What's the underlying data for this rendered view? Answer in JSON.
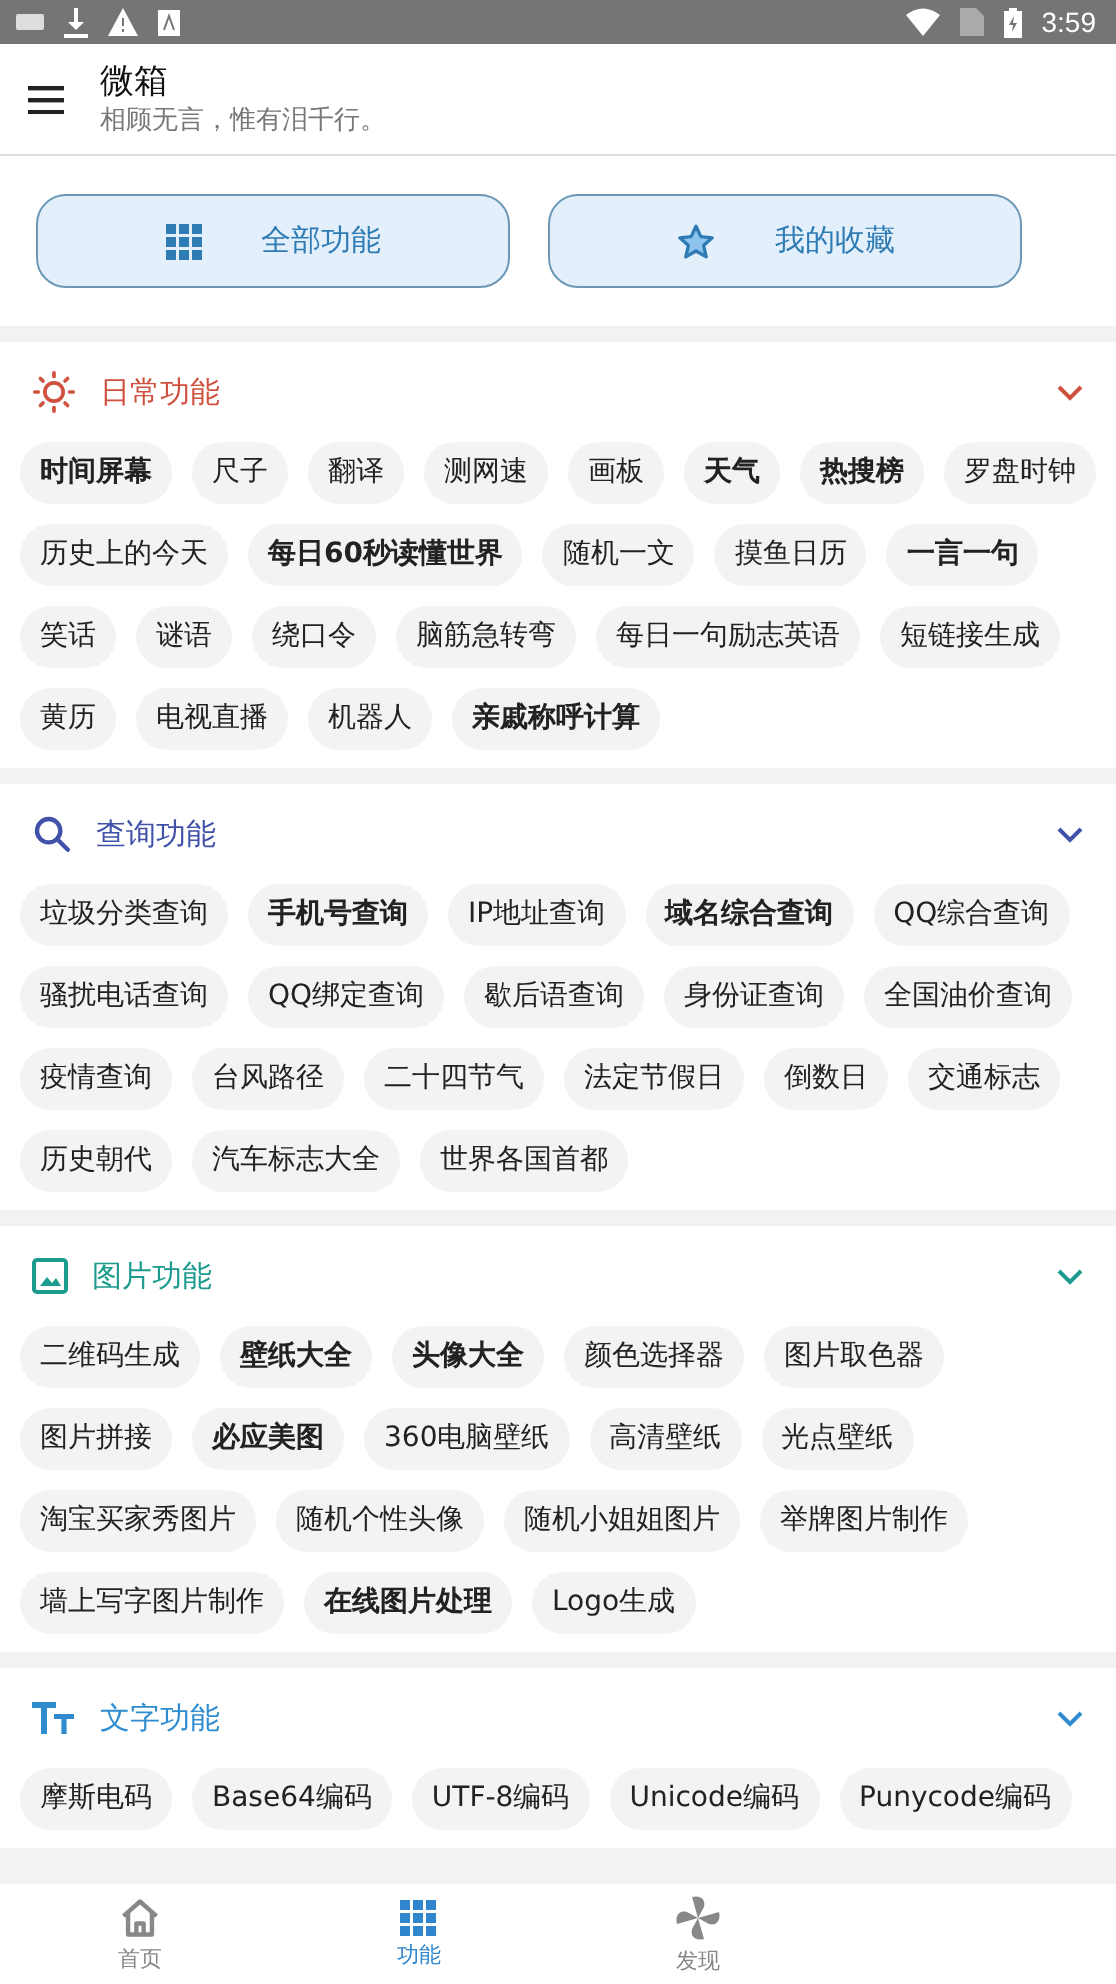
{
  "status_bar": {
    "time": "3:59"
  },
  "header": {
    "title": "微箱",
    "subtitle": "相顾无言，惟有泪千行。"
  },
  "quick_buttons": [
    {
      "kind": "grid",
      "label": "全部功能"
    },
    {
      "kind": "star",
      "label": "我的收藏"
    }
  ],
  "sections": [
    {
      "kind": "sun",
      "title": "日常功能",
      "color": "#d0513f",
      "expanded": true,
      "items": [
        {
          "label": "时间屏幕",
          "bold": true
        },
        {
          "label": "尺子",
          "bold": false
        },
        {
          "label": "翻译",
          "bold": false
        },
        {
          "label": "测网速",
          "bold": false
        },
        {
          "label": "画板",
          "bold": false
        },
        {
          "label": "天气",
          "bold": true
        },
        {
          "label": "热搜榜",
          "bold": true
        },
        {
          "label": "罗盘时钟",
          "bold": false
        },
        {
          "label": "历史上的今天",
          "bold": false
        },
        {
          "label": "每日60秒读懂世界",
          "bold": true
        },
        {
          "label": "随机一文",
          "bold": false
        },
        {
          "label": "摸鱼日历",
          "bold": false
        },
        {
          "label": "一言一句",
          "bold": true
        },
        {
          "label": "笑话",
          "bold": false
        },
        {
          "label": "谜语",
          "bold": false
        },
        {
          "label": "绕口令",
          "bold": false
        },
        {
          "label": "脑筋急转弯",
          "bold": false
        },
        {
          "label": "每日一句励志英语",
          "bold": false
        },
        {
          "label": "短链接生成",
          "bold": false
        },
        {
          "label": "黄历",
          "bold": false
        },
        {
          "label": "电视直播",
          "bold": false
        },
        {
          "label": "机器人",
          "bold": false
        },
        {
          "label": "亲戚称呼计算",
          "bold": true
        }
      ]
    },
    {
      "kind": "search",
      "title": "查询功能",
      "color": "#3f51a8",
      "expanded": true,
      "items": [
        {
          "label": "垃圾分类查询",
          "bold": false
        },
        {
          "label": "手机号查询",
          "bold": true
        },
        {
          "label": "IP地址查询",
          "bold": false
        },
        {
          "label": "域名综合查询",
          "bold": true
        },
        {
          "label": "QQ综合查询",
          "bold": false
        },
        {
          "label": "骚扰电话查询",
          "bold": false
        },
        {
          "label": "QQ绑定查询",
          "bold": false
        },
        {
          "label": "歇后语查询",
          "bold": false
        },
        {
          "label": "身份证查询",
          "bold": false
        },
        {
          "label": "全国油价查询",
          "bold": false
        },
        {
          "label": "疫情查询",
          "bold": false
        },
        {
          "label": "台风路径",
          "bold": false
        },
        {
          "label": "二十四节气",
          "bold": false
        },
        {
          "label": "法定节假日",
          "bold": false
        },
        {
          "label": "倒数日",
          "bold": false
        },
        {
          "label": "交通标志",
          "bold": false
        },
        {
          "label": "历史朝代",
          "bold": false
        },
        {
          "label": "汽车标志大全",
          "bold": false
        },
        {
          "label": "世界各国首都",
          "bold": false
        }
      ]
    },
    {
      "kind": "image",
      "title": "图片功能",
      "color": "#1b9a8e",
      "expanded": true,
      "items": [
        {
          "label": "二维码生成",
          "bold": false
        },
        {
          "label": "壁纸大全",
          "bold": true
        },
        {
          "label": "头像大全",
          "bold": true
        },
        {
          "label": "颜色选择器",
          "bold": false
        },
        {
          "label": "图片取色器",
          "bold": false
        },
        {
          "label": "图片拼接",
          "bold": false
        },
        {
          "label": "必应美图",
          "bold": true
        },
        {
          "label": "360电脑壁纸",
          "bold": false
        },
        {
          "label": "高清壁纸",
          "bold": false
        },
        {
          "label": "光点壁纸",
          "bold": false
        },
        {
          "label": "淘宝买家秀图片",
          "bold": false
        },
        {
          "label": "随机个性头像",
          "bold": false
        },
        {
          "label": "随机小姐姐图片",
          "bold": false
        },
        {
          "label": "举牌图片制作",
          "bold": false
        },
        {
          "label": "墙上写字图片制作",
          "bold": false
        },
        {
          "label": "在线图片处理",
          "bold": true
        },
        {
          "label": "Logo生成",
          "bold": false
        }
      ]
    },
    {
      "kind": "text",
      "title": "文字功能",
      "color": "#2e8ccf",
      "expanded": true,
      "items": [
        {
          "label": "摩斯电码",
          "bold": false
        },
        {
          "label": "Base64编码",
          "bold": false
        },
        {
          "label": "UTF-8编码",
          "bold": false
        },
        {
          "label": "Unicode编码",
          "bold": false
        },
        {
          "label": "Punycode编码",
          "bold": false
        }
      ]
    }
  ],
  "bottom_nav": [
    {
      "kind": "home",
      "label": "首页",
      "selected": false
    },
    {
      "kind": "grid",
      "label": "功能",
      "selected": true
    },
    {
      "kind": "pinwheel",
      "label": "发现",
      "selected": false
    }
  ]
}
